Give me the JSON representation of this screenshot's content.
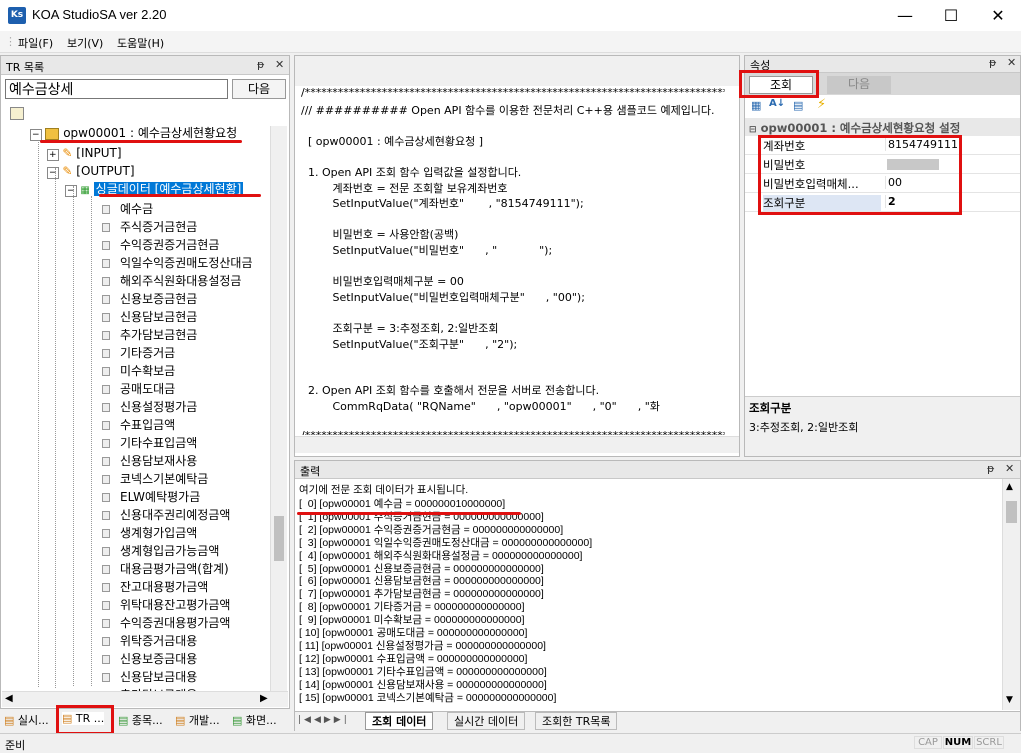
{
  "app": {
    "logo": "Ks",
    "title": "KOA StudioSA ver 2.20"
  },
  "menu": [
    "파일(F)",
    "보기(V)",
    "도움말(H)"
  ],
  "tr_panel": {
    "title": "TR 목록",
    "search_value": "예수금상세",
    "next_button": "다음",
    "root_node": "opw00001 : 예수금상세현황요청",
    "input_node": "[INPUT]",
    "output_node": "[OUTPUT]",
    "single_data_node": "싱글데이터 [예수금상세현황]",
    "fields": [
      "예수금",
      "주식증거금현금",
      "수익증권증거금현금",
      "익일수익증권매도정산대금",
      "해외주식원화대용설정금",
      "신용보증금현금",
      "신용담보금현금",
      "추가담보금현금",
      "기타증거금",
      "미수확보금",
      "공매도대금",
      "신용설정평가금",
      "수표입금액",
      "기타수표입금액",
      "신용담보재사용",
      "코넥스기본예탁금",
      "ELW예탁평가금",
      "신용대주권리예정금액",
      "생계형가입금액",
      "생계형입금가능금액",
      "대용금평가금액(합계)",
      "잔고대용평가금액",
      "위탁대용잔고평가금액",
      "수익증권대용평가금액",
      "위탁증거금대용",
      "신용보증금대용",
      "신용담보금대용",
      "추가담보금대용"
    ]
  },
  "left_tabs": [
    "실시...",
    "TR ...",
    "종목...",
    "개발...",
    "화면..."
  ],
  "code": {
    "lines": [
      "/*******************************************************************************",
      "/// ########## Open API 함수를 이용한 전문처리 C++용 샘플코드 예제입니다.",
      "",
      "  [ opw00001 : 예수금상세현황요청 ]",
      "",
      "  1. Open API 조회 함수 입력값을 설정합니다.",
      "         계좌번호 = 전문 조회할 보유계좌번호",
      "         SetInputValue(\"계좌번호\"       , \"8154749111\");",
      "",
      "         비밀번호 = 사용안함(공백)",
      "         SetInputValue(\"비밀번호\"      , \"            \");",
      "",
      "         비밀번호입력매체구분 = 00",
      "         SetInputValue(\"비밀번호입력매체구분\"      , \"00\");",
      "",
      "         조회구분 = 3:추정조회, 2:일반조회",
      "         SetInputValue(\"조회구분\"      , \"2\");",
      "",
      "",
      "  2. Open API 조회 함수를 호출해서 전문을 서버로 전송합니다.",
      "         CommRqData( \"RQName\"      , \"opw00001\"      , \"0\"      , \"화",
      "",
      "/*******************************************************************************"
    ]
  },
  "props": {
    "title": "속성",
    "query_button": "조회",
    "next_button": "다음",
    "section": "opw00001 : 예수금상세현황요청 설정",
    "rows": [
      {
        "name": "계좌번호",
        "value": "8154749111"
      },
      {
        "name": "비밀번호",
        "value": ""
      },
      {
        "name": "비밀번호입력매체...",
        "value": "00"
      },
      {
        "name": "조회구분",
        "value": "2"
      }
    ],
    "desc_title": "조회구분",
    "desc_text": "3:추정조회, 2:일반조회"
  },
  "output": {
    "title": "출력",
    "header": "여기에 전문 조회 데이터가 표시됩니다.",
    "lines": [
      "[  0] [opw00001 예수금 = 000000010000000]",
      "[  1] [opw00001 주식증거금현금 = 000000000000000]",
      "[  2] [opw00001 수익증권증거금현금 = 000000000000000]",
      "[  3] [opw00001 익일수익증권매도정산대금 = 000000000000000]",
      "[  4] [opw00001 해외주식원화대용설정금 = 000000000000000]",
      "[  5] [opw00001 신용보증금현금 = 000000000000000]",
      "[  6] [opw00001 신용담보금현금 = 000000000000000]",
      "[  7] [opw00001 추가담보금현금 = 000000000000000]",
      "[  8] [opw00001 기타증거금 = 000000000000000]",
      "[  9] [opw00001 미수확보금 = 000000000000000]",
      "[ 10] [opw00001 공매도대금 = 000000000000000]",
      "[ 11] [opw00001 신용설정평가금 = 000000000000000]",
      "[ 12] [opw00001 수표입금액 = 000000000000000]",
      "[ 13] [opw00001 기타수표입금액 = 000000000000000]",
      "[ 14] [opw00001 신용담보재사용 = 000000000000000]",
      "[ 15] [opw00001 코넥스기본예탁금 = 000000000000000]"
    ],
    "tabs": [
      "조회 데이터",
      "실시간 데이터",
      "조회한 TR목록"
    ]
  },
  "status": {
    "left": "준비",
    "caps": "CAP",
    "num": "NUM",
    "scrl": "SCRL"
  }
}
